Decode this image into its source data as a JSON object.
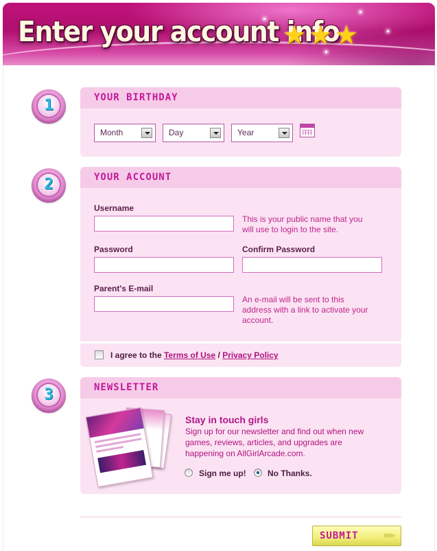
{
  "header": {
    "title": "Enter your account info",
    "stars": [
      "★",
      "★",
      "★"
    ]
  },
  "steps": {
    "one": "1",
    "two": "2",
    "three": "3"
  },
  "birthday": {
    "heading": "Your Birthday",
    "month": "Month",
    "day": "Day",
    "year": "Year"
  },
  "account": {
    "heading": "Your Account",
    "username_label": "Username",
    "username_hint_1": "This is your public name that you",
    "username_hint_2": "will use to login to the site.",
    "password_label": "Password",
    "confirm_label": "Confirm Password",
    "email_label": "Parent's E-mail",
    "email_hint_1": "An e-mail will be sent to this",
    "email_hint_2": "address with a link to activate your",
    "email_hint_3": "account.",
    "agree_prefix": "I agree to the",
    "terms": "Terms of Use",
    "separator": "/",
    "privacy": "Privacy Policy"
  },
  "newsletter": {
    "heading": "Newsletter",
    "title": "Stay in touch girls",
    "body_1": "Sign up for our newsletter and find out when new",
    "body_2": "games, reviews, articles, and upgrades are",
    "body_3": "happening on AllGirlArcade.com.",
    "option_yes": "Sign me up!",
    "option_no": "No Thanks.",
    "selected": "No Thanks."
  },
  "submit_label": "SUBMIT",
  "submit_arrows": "▶▶▶",
  "colors": {
    "brand_magenta": "#c2189a",
    "panel_bg": "#fbe3f3",
    "panel_head": "#f6cbe8",
    "header_bg": "#b0106f",
    "submit_bg": "#f2ef7a"
  }
}
